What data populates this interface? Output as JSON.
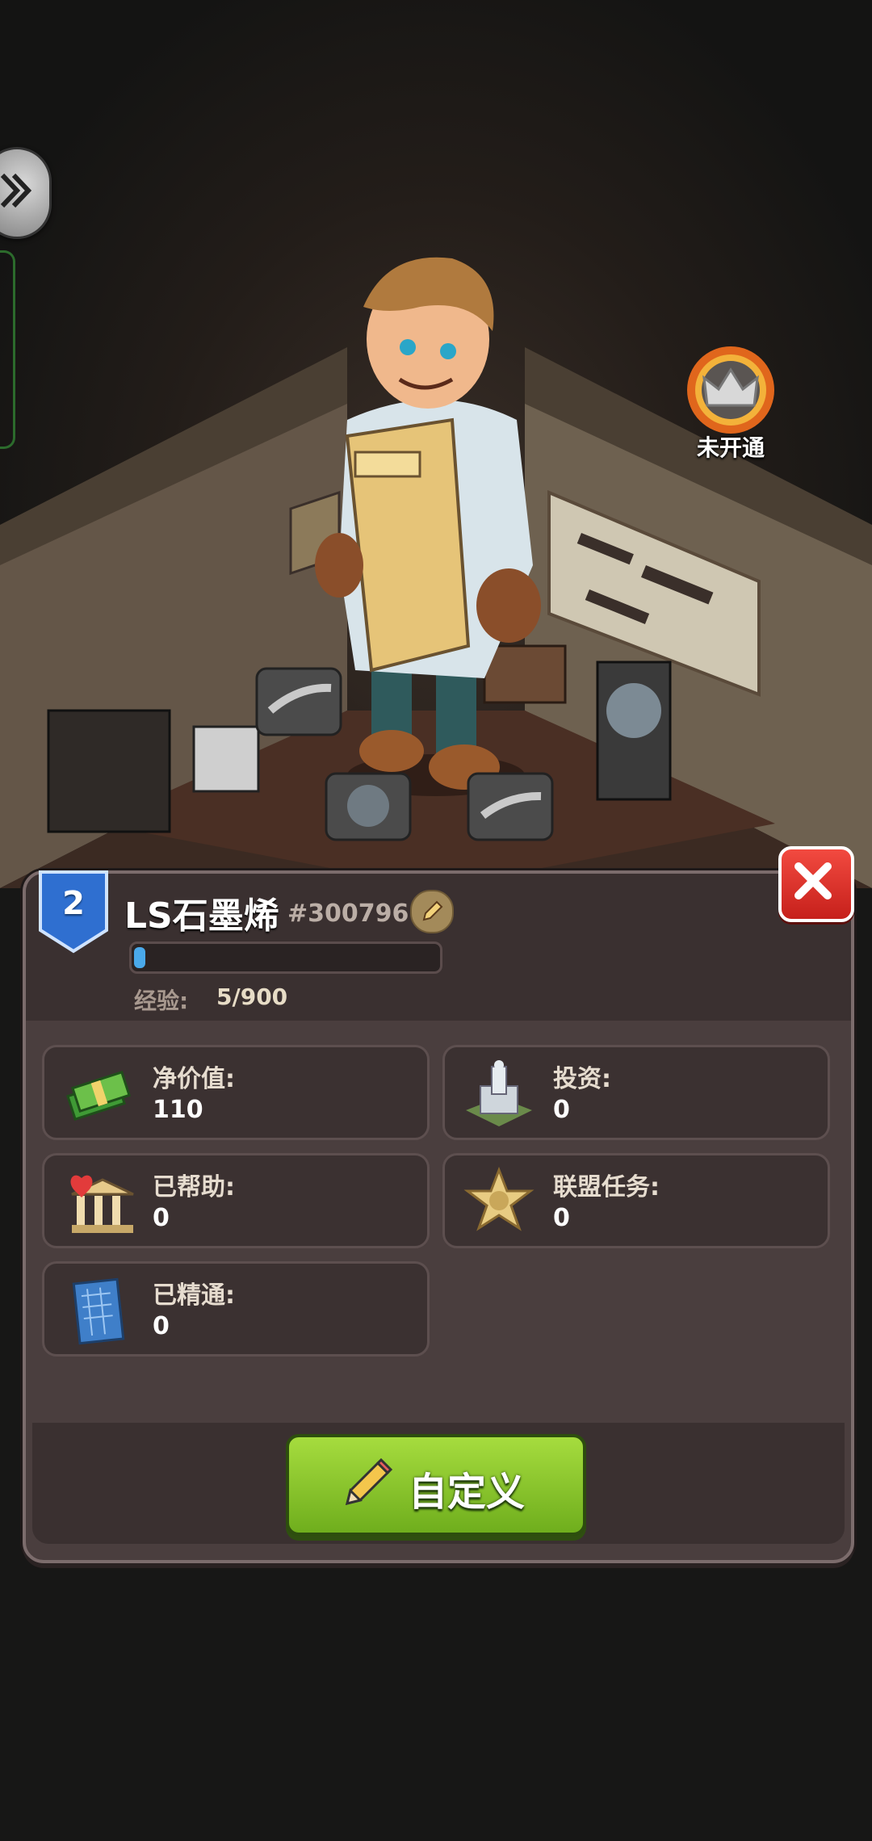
{
  "scene": {
    "crown_badge_label": "未开通"
  },
  "profile": {
    "level": "2",
    "name": "LS石墨烯",
    "player_id": "#300796",
    "xp_progress": 0.015,
    "xp_label": "经验:",
    "xp_value": "5/900"
  },
  "stats": [
    {
      "label": "净价值:",
      "value": "110",
      "icon": "cash-stack-icon"
    },
    {
      "label": "投资:",
      "value": "0",
      "icon": "building-icon"
    },
    {
      "label": "已帮助:",
      "value": "0",
      "icon": "heart-bank-icon"
    },
    {
      "label": "联盟任务:",
      "value": "0",
      "icon": "sheriff-star-icon"
    },
    {
      "label": "已精通:",
      "value": "0",
      "icon": "blueprint-icon"
    }
  ],
  "actions": {
    "customize_label": "自定义"
  },
  "colors": {
    "panel": "#4a3e3e",
    "close_red": "#e0342c",
    "button_green": "#8cc832",
    "xp_blue": "#4aa9ea",
    "level_blue": "#2f6fd0"
  }
}
